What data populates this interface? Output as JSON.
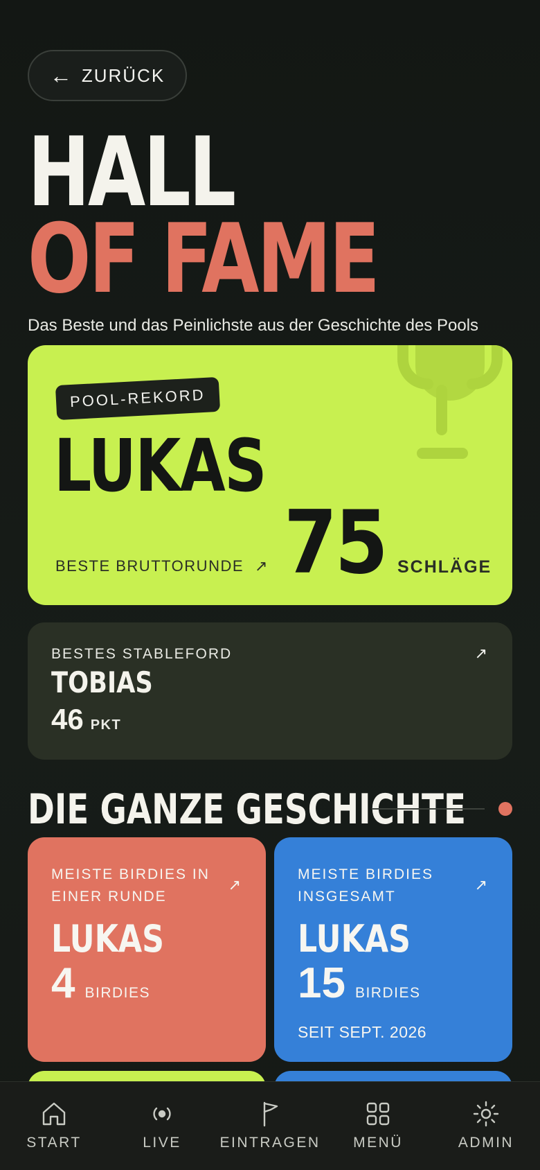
{
  "back": {
    "arrow": "←",
    "label": "ZURÜCK"
  },
  "title": {
    "line1": "HALL",
    "line2": "OF FAME"
  },
  "subtitle": "Das Beste und das Peinlichste aus der Geschichte des Pools",
  "record": {
    "badge": "POOL-REKORD",
    "name": "LUKAS",
    "label": "BESTE BRUTTORUNDE",
    "value": "75",
    "unit": "SCHLÄGE"
  },
  "stableford": {
    "label": "BESTES STABLEFORD",
    "name": "TOBIAS",
    "value": "46",
    "unit": "PKT"
  },
  "section": {
    "title": "DIE GANZE GESCHICHTE"
  },
  "tiles": [
    {
      "label": "MEISTE BIRDIES IN EINER RUNDE",
      "name": "LUKAS",
      "value": "4",
      "unit": "BIRDIES",
      "since": ""
    },
    {
      "label": "MEISTE BIRDIES INSGESAMT",
      "name": "LUKAS",
      "value": "15",
      "unit": "BIRDIES",
      "since": "SEIT SEPT. 2026"
    }
  ],
  "nav": [
    {
      "label": "START",
      "icon": "home-icon"
    },
    {
      "label": "LIVE",
      "icon": "live-broadcast-icon"
    },
    {
      "label": "EINTRAGEN",
      "icon": "flag-icon"
    },
    {
      "label": "MENÜ",
      "icon": "grid-icon"
    },
    {
      "label": "ADMIN",
      "icon": "sun-settings-icon"
    }
  ],
  "colors": {
    "background": "#151916",
    "accent_red": "#e07360",
    "accent_lime": "#c8f050",
    "accent_blue": "#3580d8",
    "card_dark": "#2a3025"
  },
  "arrow_glyph": "↗"
}
